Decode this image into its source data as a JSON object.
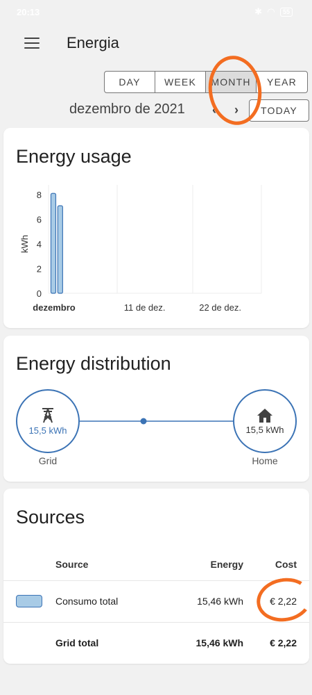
{
  "status_bar": {
    "time": "20:13",
    "battery": "55"
  },
  "header": {
    "title": "Energia"
  },
  "period_selector": {
    "options": [
      {
        "label": "DAY",
        "active": false
      },
      {
        "label": "WEEK",
        "active": false
      },
      {
        "label": "MONTH",
        "active": true
      },
      {
        "label": "YEAR",
        "active": false
      }
    ]
  },
  "date_nav": {
    "current": "dezembro de 2021",
    "prev": "‹",
    "next": "›",
    "today_label": "TODAY"
  },
  "energy_usage": {
    "title": "Energy usage",
    "chart_data": {
      "type": "bar",
      "ylabel": "kWh",
      "ylim": [
        0,
        8
      ],
      "yticks": [
        0,
        2,
        4,
        6,
        8
      ],
      "xticks": [
        "dezembro",
        "11 de dez.",
        "22 de dez."
      ],
      "x": [
        1,
        2
      ],
      "values": [
        8.1,
        7.1
      ],
      "bar_color": "#a8cbe6",
      "bar_stroke": "#3b73b5"
    }
  },
  "energy_distribution": {
    "title": "Energy distribution",
    "grid": {
      "label": "Grid",
      "value": "15,5 kWh",
      "icon": "transmission-tower-icon"
    },
    "home": {
      "label": "Home",
      "value": "15,5 kWh",
      "icon": "home-icon"
    }
  },
  "sources": {
    "title": "Sources",
    "columns": [
      "Source",
      "Energy",
      "Cost"
    ],
    "rows": [
      {
        "name": "Consumo total",
        "energy": "15,46 kWh",
        "cost": "€ 2,22"
      }
    ],
    "total": {
      "name": "Grid total",
      "energy": "15,46 kWh",
      "cost": "€ 2,22"
    }
  },
  "colors": {
    "accent": "#3b73b5",
    "annotation": "#f36d21",
    "bar": "#a8cbe6"
  }
}
